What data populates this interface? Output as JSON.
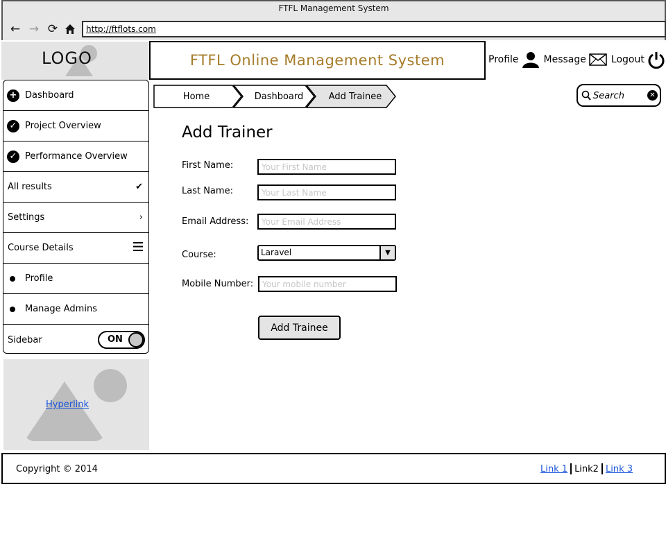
{
  "browser": {
    "window_title": "FTFL Management System",
    "url": "http://ftflots.com"
  },
  "header": {
    "logo_text": "LOGO",
    "title": "FTFL Online Management System",
    "title_color": "#a67c2a",
    "links": [
      {
        "label": "Profile",
        "icon": "user-icon"
      },
      {
        "label": "Message",
        "icon": "envelope-icon"
      },
      {
        "label": "Logout",
        "icon": "power-icon"
      }
    ]
  },
  "sidebar": {
    "items": [
      {
        "label": "Dashboard",
        "icon": "plus-circle-icon"
      },
      {
        "label": "Project Overview",
        "icon": "check-circle-icon"
      },
      {
        "label": "Performance Overview",
        "icon": "check-circle-icon"
      },
      {
        "label": "All results",
        "trailing_icon": "checkmark-icon"
      },
      {
        "label": "Settings",
        "trailing_icon": "chevron-right-icon"
      },
      {
        "label": "Course Details",
        "trailing_icon": "hamburger-icon"
      },
      {
        "label": "Profile",
        "icon": "bullet-icon"
      },
      {
        "label": "Manage Admins",
        "icon": "bullet-icon"
      },
      {
        "label": "Sidebar",
        "toggle": {
          "state": "ON",
          "on": true
        }
      }
    ]
  },
  "image_placeholder": {
    "link_text": "Hyperlink"
  },
  "breadcrumb": [
    {
      "label": "Home",
      "active": false
    },
    {
      "label": "Dashboard",
      "active": false
    },
    {
      "label": "Add Trainee",
      "active": true
    }
  ],
  "search": {
    "placeholder": "Search"
  },
  "form": {
    "title": "Add Trainer",
    "fields": {
      "first_name": {
        "label": "First Name:",
        "placeholder": "Your First Name"
      },
      "last_name": {
        "label": "Last Name:",
        "placeholder": "Your Last Name"
      },
      "email": {
        "label": "Email Address:",
        "placeholder": "Your Email Address"
      },
      "course": {
        "label": "Course:",
        "value": "Laravel"
      },
      "mobile": {
        "label": "Mobile Number:",
        "placeholder": "Your mobile number"
      }
    },
    "submit_label": "Add Trainee"
  },
  "footer": {
    "copyright": "Copyright © 2014",
    "links": [
      {
        "label": "Link 1",
        "current": false
      },
      {
        "label": "Link2",
        "current": true
      },
      {
        "label": "Link 3",
        "current": false
      }
    ]
  }
}
